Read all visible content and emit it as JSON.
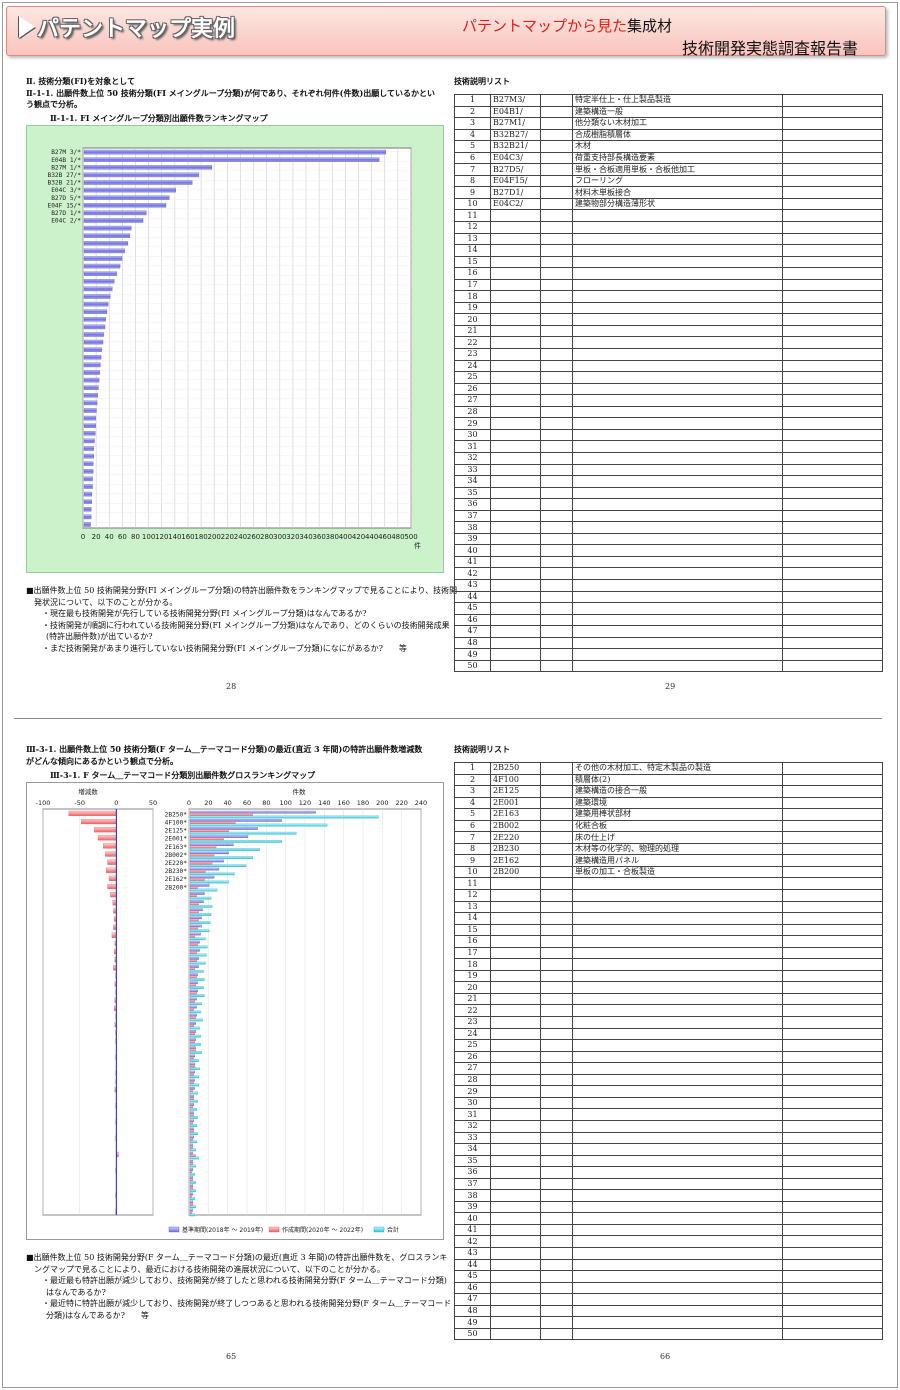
{
  "header": {
    "title": "パテントマップ実例",
    "subtitle_red": "パテントマップから見た",
    "subtitle_subject": "集成材",
    "subtitle_report": "技術開発実態調査報告書"
  },
  "top": {
    "section": "Ⅱ. 技術分類(FI)を対象として",
    "heading_line1": "Ⅱ-1-1. 出願件数上位 50 技術分類(FI メイングループ分類)が何であり、それぞれ何件(件数)出願しているかとい",
    "heading_line2": "う観点で分析。",
    "figure_title": "Ⅱ-1-1. FI メイングループ分類別出願件数ランキングマップ",
    "axis_unit": "件",
    "note_lines": [
      "■出願件数上位 50 技術開発分野(FI メイングループ分類)の特許出願件数をランキングマップで見ることにより、技術開",
      "発状況について、以下のことが分かる。",
      "・現在最も技術開発が先行している技術開発分野(FI メイングループ分類)はなんであるか?",
      "・技術開発が順調に行われている技術開発分野(FI メイングループ分類)はなんであり、どのくらいの技術開発成果",
      "(特許出願件数)が出ているか?",
      "・まだ技術開発があまり進行していない技術開発分野(FI メイングループ分類)になにがあるか?　　等"
    ],
    "page_left": "28",
    "page_right": "29",
    "table_title": "技術説明リスト",
    "table_rows": [
      [
        "1",
        "B27M3/",
        "特定半仕上・仕上製品製造"
      ],
      [
        "2",
        "E04B1/",
        "建築構造一般"
      ],
      [
        "3",
        "B27M1/",
        "他分類ない木材加工"
      ],
      [
        "4",
        "B32B27/",
        "合成樹脂積層体"
      ],
      [
        "5",
        "B32B21/",
        "木材"
      ],
      [
        "6",
        "E04C3/",
        "荷重支持部長構造要素"
      ],
      [
        "7",
        "B27D5/",
        "単板・合板適用単板・合板他加工"
      ],
      [
        "8",
        "E04F15/",
        "フローリング"
      ],
      [
        "9",
        "B27D1/",
        "材料木単板接合"
      ],
      [
        "10",
        "E04C2/",
        "建築物部分構造薄形状"
      ]
    ]
  },
  "bottom": {
    "heading_line1": "Ⅲ-3-1. 出願件数上位 50 技術分類(F ターム＿テーマコード分類)の最近(直近 3 年間)の特許出願件数増減数",
    "heading_line2": "がどんな傾向にあるかという観点で分析。",
    "figure_title": "Ⅲ-3-1. F ターム＿テーマコード分類別出願件数グロスランキングマップ",
    "left_axis_title": "増減数",
    "right_axis_title": "件数",
    "legend_base": "基準期間(2018年 ～ 2019年)",
    "legend_recent": "作成期間(2020年 ～ 2022年)",
    "legend_total": "合計",
    "note_lines": [
      "■出願件数上位 50 技術開発分野(F ターム＿テーマコード分類)の最近(直近 3 年間)の特許出願件数を、グロスランキ",
      "ングマップで見ることにより、最近における技術開発の進展状況について、以下のことが分かる。",
      "・最近最も特許出願が減少しており、技術開発が終了したと思われる技術開発分野(F ターム＿テーマコード分類)",
      "はなんであるか?",
      "・最近特に特許出願が減少しており、技術開発が終了しつつあると思われる技術開発分野(F ターム＿テーマコード",
      "分類)はなんであるか?　　等"
    ],
    "page_left": "65",
    "page_right": "66",
    "table_title": "技術説明リスト",
    "table_rows": [
      [
        "1",
        "2B250",
        "その他の木材加工、特定木製品の製造"
      ],
      [
        "2",
        "4F100",
        "積層体(2)"
      ],
      [
        "3",
        "2E125",
        "建築構造の接合一般"
      ],
      [
        "4",
        "2E001",
        "建築環境"
      ],
      [
        "5",
        "2E163",
        "建築用棒状部材"
      ],
      [
        "6",
        "2B002",
        "化粧合板"
      ],
      [
        "7",
        "2E220",
        "床の仕上げ"
      ],
      [
        "8",
        "2B230",
        "木材等の化学的、物理的処理"
      ],
      [
        "9",
        "2E162",
        "建築構造用パネル"
      ],
      [
        "10",
        "2B200",
        "単板の加工・合板製造"
      ]
    ]
  },
  "chart_data": [
    {
      "type": "bar",
      "orientation": "horizontal",
      "title": "Ⅱ-1-1. FI メイングループ分類別出願件数ランキングマップ",
      "xlabel": "件",
      "xlim": [
        0,
        500
      ],
      "xticks": [
        0,
        20,
        40,
        60,
        80,
        100,
        120,
        140,
        160,
        180,
        200,
        220,
        240,
        260,
        280,
        300,
        320,
        340,
        360,
        380,
        400,
        420,
        440,
        460,
        480,
        500
      ],
      "grid": true,
      "categories": [
        "B27M 3/*",
        "E04B 1/*",
        "B27M 1/*",
        "B32B 27/*",
        "B32B 21/*",
        "E04C 3/*",
        "B27D 5/*",
        "E04F 15/*",
        "B27D 1/*",
        "E04C 2/*",
        "",
        "",
        "",
        "",
        "",
        "",
        "",
        "",
        "",
        "",
        "",
        "",
        "",
        "",
        "",
        "",
        "",
        "",
        "",
        "",
        "",
        "",
        "",
        "",
        "",
        "",
        "",
        "",
        "",
        "",
        "",
        "",
        "",
        "",
        "",
        "",
        "",
        "",
        "",
        ""
      ],
      "values": [
        460,
        450,
        195,
        175,
        165,
        140,
        130,
        125,
        95,
        90,
        72,
        70,
        67,
        62,
        58,
        55,
        50,
        46,
        43,
        40,
        37,
        35,
        33,
        32,
        30,
        29,
        27,
        26,
        25,
        24,
        23,
        22,
        21,
        20,
        19,
        18,
        18,
        17,
        16,
        15,
        15,
        14,
        14,
        13,
        13,
        12,
        12,
        11,
        11,
        10
      ]
    },
    {
      "type": "bar",
      "orientation": "horizontal",
      "title": "Ⅲ-3-1. F ターム＿テーマコード分類別出願件数グロスランキングマップ",
      "left_panel": {
        "xlabel": "増減数",
        "xlim": [
          -100,
          50
        ],
        "xticks": [
          -100,
          -50,
          0,
          50
        ],
        "values": [
          -65,
          -48,
          -30,
          -25,
          -18,
          -15,
          -12,
          -14,
          -10,
          -12,
          -8,
          -5,
          -4,
          -3,
          -4,
          -6,
          -2,
          -3,
          -2,
          -4,
          -1,
          -2,
          -1,
          -2,
          -3,
          -1,
          -2,
          -1,
          -1,
          0,
          -1,
          0,
          -1,
          -1,
          -2,
          0,
          -1,
          0,
          -1,
          0,
          -1,
          0,
          3,
          0,
          -1,
          0,
          0,
          -1,
          0,
          -1
        ]
      },
      "right_panel": {
        "xlabel": "件数",
        "xlim": [
          0,
          240
        ],
        "xticks": [
          0,
          20,
          40,
          60,
          80,
          100,
          120,
          140,
          160,
          180,
          200,
          220,
          240
        ]
      },
      "categories": [
        "2B250*",
        "4F100*",
        "2E125*",
        "2E001*",
        "2E163*",
        "2B002*",
        "2E220*",
        "2B230*",
        "2E162*",
        "2B200*",
        "",
        "",
        "",
        "",
        "",
        "",
        "",
        "",
        "",
        "",
        "",
        "",
        "",
        "",
        "",
        "",
        "",
        "",
        "",
        "",
        "",
        "",
        "",
        "",
        "",
        "",
        "",
        "",
        "",
        "",
        "",
        "",
        "",
        "",
        "",
        "",
        "",
        "",
        "",
        ""
      ],
      "series": [
        {
          "name": "基準期間(2018年 ～ 2019年)",
          "color": "#7f7fe0",
          "values": [
            130,
            95,
            70,
            60,
            45,
            40,
            35,
            30,
            25,
            20,
            15,
            14,
            13,
            12,
            12,
            11,
            10,
            10,
            9,
            9,
            8,
            8,
            8,
            7,
            7,
            7,
            6,
            6,
            6,
            6,
            5,
            5,
            5,
            5,
            5,
            4,
            4,
            4,
            4,
            4,
            4,
            3,
            3,
            3,
            3,
            3,
            3,
            3,
            3,
            3
          ]
        },
        {
          "name": "作成期間(2020年 ～ 2022年)",
          "color": "#f08080",
          "values": [
            65,
            47,
            40,
            35,
            27,
            25,
            23,
            16,
            15,
            8,
            7,
            9,
            9,
            9,
            8,
            5,
            8,
            7,
            7,
            5,
            7,
            6,
            7,
            5,
            4,
            6,
            4,
            5,
            5,
            6,
            4,
            5,
            4,
            4,
            3,
            4,
            3,
            4,
            3,
            4,
            3,
            3,
            6,
            3,
            2,
            3,
            3,
            2,
            3,
            2
          ]
        },
        {
          "name": "合計",
          "color": "#40d0e0",
          "values": [
            195,
            142,
            110,
            95,
            72,
            65,
            58,
            46,
            40,
            28,
            22,
            23,
            22,
            21,
            20,
            16,
            18,
            17,
            16,
            14,
            15,
            14,
            15,
            12,
            11,
            13,
            10,
            11,
            11,
            12,
            9,
            10,
            9,
            9,
            8,
            8,
            7,
            8,
            7,
            8,
            7,
            6,
            9,
            6,
            5,
            6,
            6,
            5,
            6,
            5
          ]
        }
      ]
    }
  ]
}
